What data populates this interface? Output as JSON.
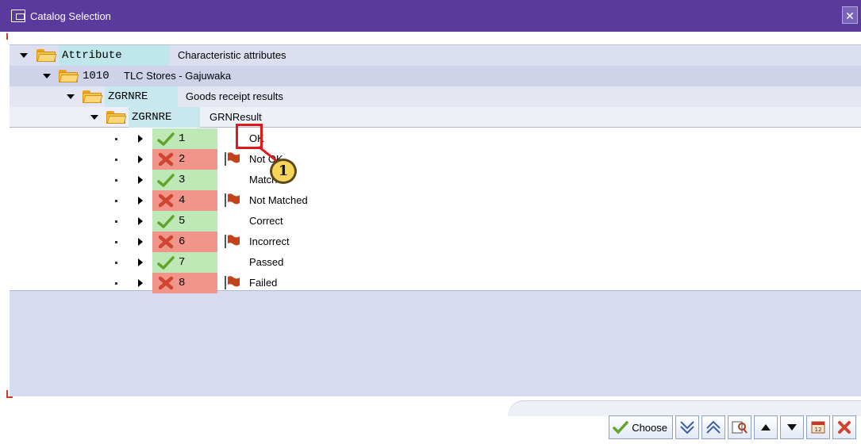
{
  "window": {
    "title": "Catalog Selection",
    "close_glyph": "✕"
  },
  "tree": {
    "nodes": [
      {
        "key": "Attribute",
        "desc": "Characteristic attributes"
      },
      {
        "key": "1010",
        "desc": "TLC Stores - Gajuwaka"
      },
      {
        "key": "ZGRNRE",
        "desc": "Goods receipt results"
      },
      {
        "key": "ZGRNRE",
        "desc": "GRNResult"
      }
    ],
    "items": [
      {
        "num": "1",
        "status": "accepted",
        "label": "OK"
      },
      {
        "num": "2",
        "status": "rejected",
        "label": "Not OK"
      },
      {
        "num": "3",
        "status": "accepted",
        "label": "Matched"
      },
      {
        "num": "4",
        "status": "rejected",
        "label": "Not Matched"
      },
      {
        "num": "5",
        "status": "accepted",
        "label": "Correct"
      },
      {
        "num": "6",
        "status": "rejected",
        "label": "Incorrect"
      },
      {
        "num": "7",
        "status": "accepted",
        "label": "Passed"
      },
      {
        "num": "8",
        "status": "rejected",
        "label": "Failed"
      }
    ]
  },
  "callout": {
    "number": "1"
  },
  "toolbar": {
    "choose_label": "Choose",
    "buttons": [
      "checkmark-icon",
      "filter-down-icon",
      "filter-up-icon",
      "find-icon",
      "arrow-up-icon",
      "arrow-down-icon",
      "calendar-icon",
      "cancel-icon"
    ]
  },
  "colors": {
    "titlebar": "#5b3a9e",
    "accepted": "#bfe8b7",
    "rejected": "#f1958a",
    "callout": "#e01919"
  }
}
